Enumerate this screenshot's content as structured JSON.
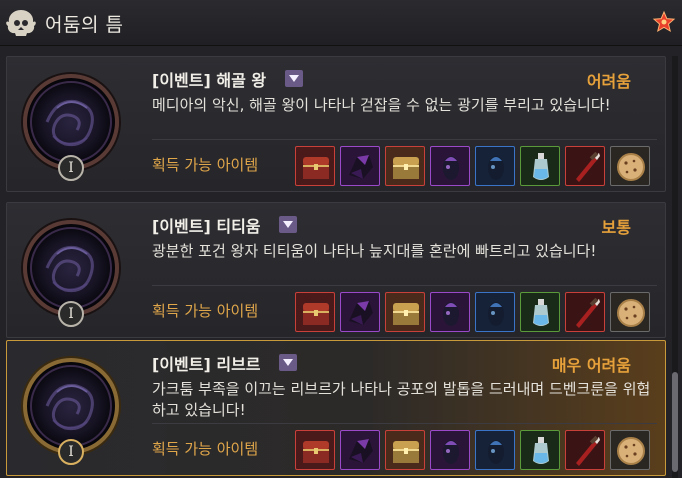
{
  "window": {
    "title": "어둠의 틈"
  },
  "loot_label": "획득 가능 아이템",
  "entries": [
    {
      "name": "[이벤트] 해골 왕",
      "difficulty": "어려움",
      "description": "메디아의 악신, 해골 왕이 나타나 걷잡을 수 없는 광기를 부리고 있습니다!",
      "level": "I",
      "selected": false
    },
    {
      "name": "[이벤트] 티티움",
      "difficulty": "보통",
      "description": "광분한 포건 왕자 티티움이 나타나 늪지대를 혼란에 빠트리고 있습니다!",
      "level": "I",
      "selected": false
    },
    {
      "name": "[이벤트] 리브르",
      "difficulty": "매우 어려움",
      "description": "가크툼 부족을 이끄는 리브르가 나타나 공포의 발톱을 드러내며 드벤크룬을 위협하고 있습니다!",
      "level": "I",
      "selected": true
    }
  ],
  "loot_items": [
    {
      "icon": "red-treasure-chest-icon",
      "border": "#c9403a",
      "bg": "#4a1a1a"
    },
    {
      "icon": "black-crystal-armor-icon",
      "border": "#9a4ac8",
      "bg": "#2a1538"
    },
    {
      "icon": "golden-treasure-chest-icon",
      "border": "#c9403a",
      "bg": "#4a2a1a"
    },
    {
      "icon": "black-stone-armor-icon",
      "border": "#9a4ac8",
      "bg": "#2a1538"
    },
    {
      "icon": "black-stone-weapon-icon",
      "border": "#3a74c8",
      "bg": "#152238"
    },
    {
      "icon": "elixir-bottle-icon",
      "border": "#5a9a3a",
      "bg": "#1a2a18"
    },
    {
      "icon": "blood-dagger-icon",
      "border": "#c9403a",
      "bg": "#3a1414"
    },
    {
      "icon": "cookie-icon",
      "border": "#6a6a6a",
      "bg": "#2a2622"
    }
  ],
  "colors": {
    "accent": "#e7a13a",
    "selected_border": "#c99a3a"
  }
}
